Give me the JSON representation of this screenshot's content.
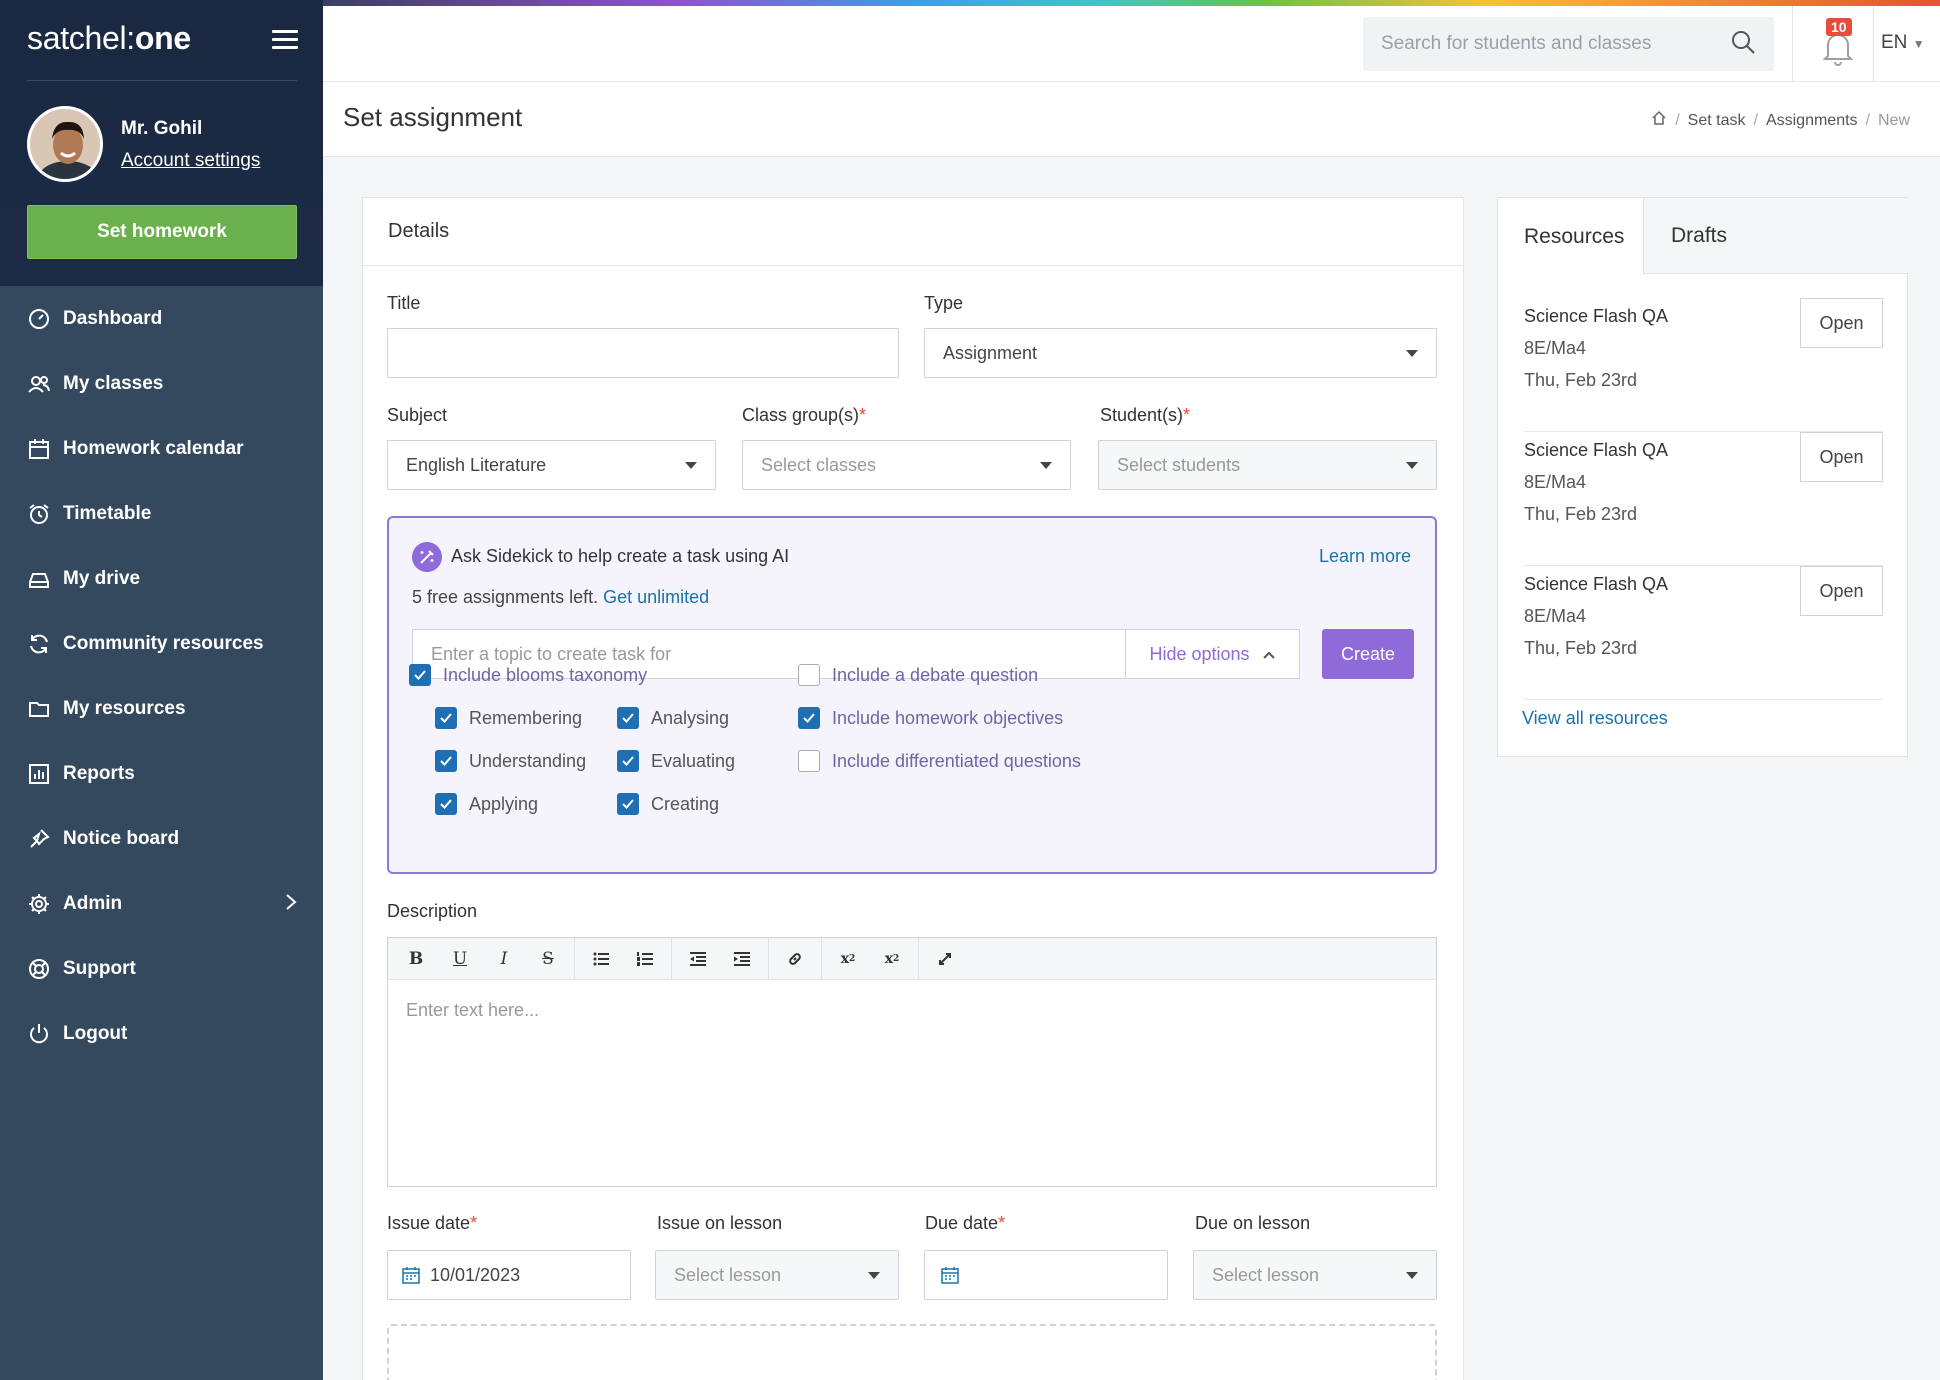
{
  "brand": {
    "logo_light": "satchel:",
    "logo_bold": "one"
  },
  "user": {
    "name": "Mr. Gohil",
    "account_link": "Account settings"
  },
  "sidebar": {
    "cta": "Set homework",
    "items": [
      {
        "label": "Dashboard",
        "icon": "dashboard-icon"
      },
      {
        "label": "My classes",
        "icon": "users-icon"
      },
      {
        "label": "Homework calendar",
        "icon": "calendar-icon"
      },
      {
        "label": "Timetable",
        "icon": "alarm-clock-icon"
      },
      {
        "label": "My drive",
        "icon": "drive-icon"
      },
      {
        "label": "Community resources",
        "icon": "refresh-icon"
      },
      {
        "label": "My resources",
        "icon": "folder-icon"
      },
      {
        "label": "Reports",
        "icon": "reports-icon"
      },
      {
        "label": "Notice board",
        "icon": "pin-icon"
      },
      {
        "label": "Admin",
        "icon": "gear-icon"
      },
      {
        "label": "Support",
        "icon": "lifebuoy-icon"
      },
      {
        "label": "Logout",
        "icon": "power-icon"
      }
    ]
  },
  "header": {
    "search_placeholder": "Search for students and classes",
    "notifications": "10",
    "language": "EN"
  },
  "page": {
    "title": "Set assignment",
    "breadcrumb": [
      "Set task",
      "Assignments",
      "New"
    ]
  },
  "form": {
    "card_title": "Details",
    "title_label": "Title",
    "type_label": "Type",
    "type_value": "Assignment",
    "subject_label": "Subject",
    "subject_value": "English Literature",
    "class_label": "Class group(s)",
    "class_placeholder": "Select classes",
    "student_label": "Student(s)",
    "student_placeholder": "Select students",
    "required_mark": "*"
  },
  "ai": {
    "title": "Ask Sidekick to help create a task using AI",
    "learn_more": "Learn more",
    "free_text": "5 free assignments left.",
    "unlimited": "Get unlimited",
    "topic_placeholder": "Enter a topic to create task for",
    "hide_options": "Hide options",
    "create": "Create",
    "options": {
      "blooms": {
        "label": "Include blooms taxonomy",
        "checked": true
      },
      "remembering": {
        "label": "Remembering",
        "checked": true
      },
      "understanding": {
        "label": "Understanding",
        "checked": true
      },
      "applying": {
        "label": "Applying",
        "checked": true
      },
      "analysing": {
        "label": "Analysing",
        "checked": true
      },
      "evaluating": {
        "label": "Evaluating",
        "checked": true
      },
      "creating": {
        "label": "Creating",
        "checked": true
      },
      "debate": {
        "label": "Include a debate question",
        "checked": false
      },
      "objectives": {
        "label": "Include homework objectives",
        "checked": true
      },
      "differentiated": {
        "label": "Include differentiated questions",
        "checked": false
      }
    }
  },
  "description": {
    "label": "Description",
    "placeholder": "Enter text here..."
  },
  "dates": {
    "issue_label": "Issue date",
    "issue_value": "10/01/2023",
    "issue_lesson_label": "Issue on lesson",
    "issue_lesson_placeholder": "Select lesson",
    "due_label": "Due date",
    "due_lesson_label": "Due on lesson",
    "due_lesson_placeholder": "Select lesson"
  },
  "resources": {
    "tabs": [
      "Resources",
      "Drafts"
    ],
    "items": [
      {
        "title": "Science Flash QA",
        "class": "8E/Ma4",
        "date": "Thu, Feb 23rd",
        "action": "Open"
      },
      {
        "title": "Science Flash QA",
        "class": "8E/Ma4",
        "date": "Thu, Feb 23rd",
        "action": "Open"
      },
      {
        "title": "Science Flash QA",
        "class": "8E/Ma4",
        "date": "Thu, Feb 23rd",
        "action": "Open"
      }
    ],
    "view_all": "View all resources"
  },
  "colors": {
    "sidebar": "#34495e",
    "sidebar_top": "#1c2b45",
    "green": "#6ab04c",
    "purple": "#8e6bd8",
    "blue": "#1e6fb3",
    "link": "#1a73a8"
  }
}
